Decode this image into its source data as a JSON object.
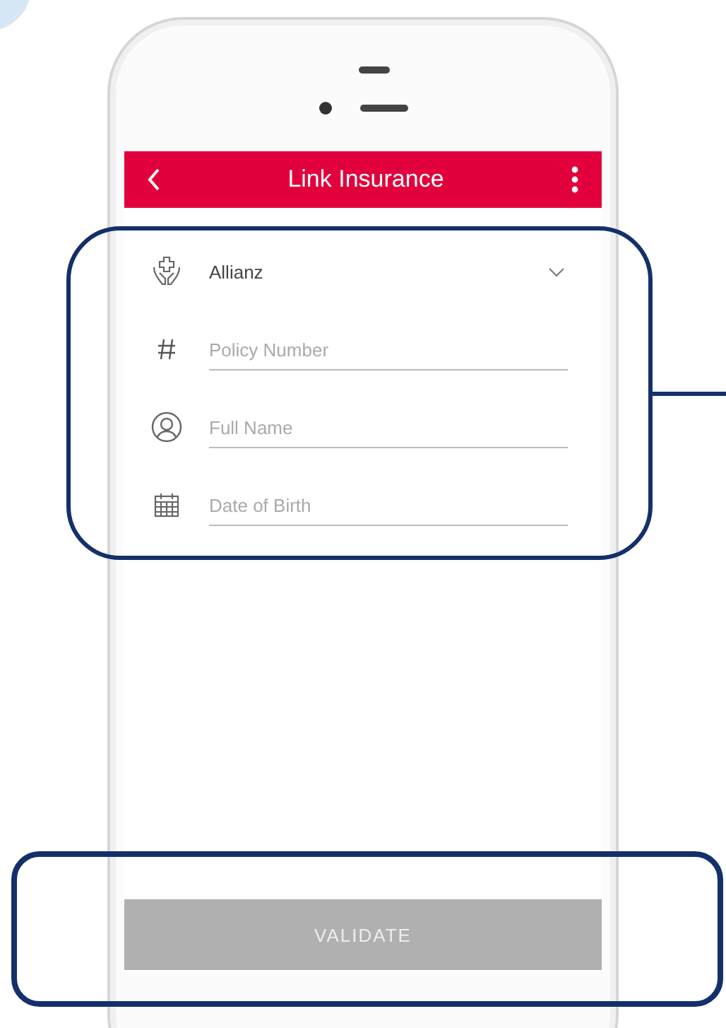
{
  "app_bar": {
    "title": "Link Insurance"
  },
  "fields": [
    {
      "kind": "dropdown",
      "value": "Allianz"
    },
    {
      "kind": "number",
      "placeholder": "Policy Number"
    },
    {
      "kind": "name",
      "placeholder": "Full Name"
    },
    {
      "kind": "date",
      "placeholder": "Date of Birth"
    }
  ],
  "validate_button": {
    "label": "VALIDATE",
    "disabled": true
  }
}
